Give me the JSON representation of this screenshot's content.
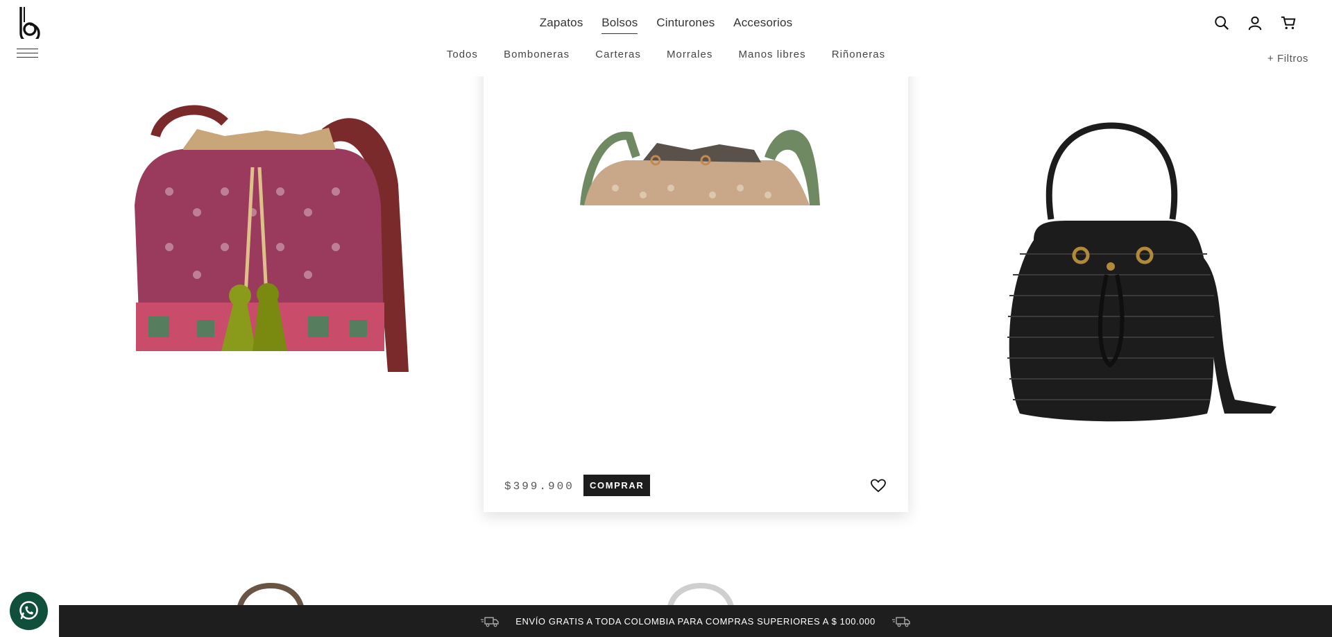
{
  "header": {
    "main_nav": [
      "Zapatos",
      "Bolsos",
      "Cinturones",
      "Accesorios"
    ],
    "active_main": "Bolsos",
    "sub_nav": [
      "Todos",
      "Bomboneras",
      "Carteras",
      "Morrales",
      "Manos libres",
      "Riñoneras"
    ],
    "filters_label": "+ Filtros",
    "icons": [
      "search-icon",
      "user-icon",
      "cart-icon"
    ]
  },
  "products": [
    {
      "colors": {
        "body": "#9a3a5c",
        "trim": "#c9a57a",
        "strap": "#7a2a2a",
        "tassel": "#8a9a1a"
      }
    },
    {
      "price": "$399.900",
      "buy_label": "COMPRAR",
      "colors": {
        "body": "#c9a88a",
        "trim": "#5a524a",
        "strap": "#6f8a62"
      }
    },
    {
      "colors": {
        "body": "#1c1c1c",
        "hardware": "#b08a3a"
      }
    }
  ],
  "shipping_bar": {
    "text": "ENVÍO GRATIS A TODA COLOMBIA PARA COMPRAS SUPERIORES A $ 100.000"
  },
  "colors": {
    "bar_bg": "#1e1e1e",
    "whatsapp": "#0f4f3b"
  }
}
